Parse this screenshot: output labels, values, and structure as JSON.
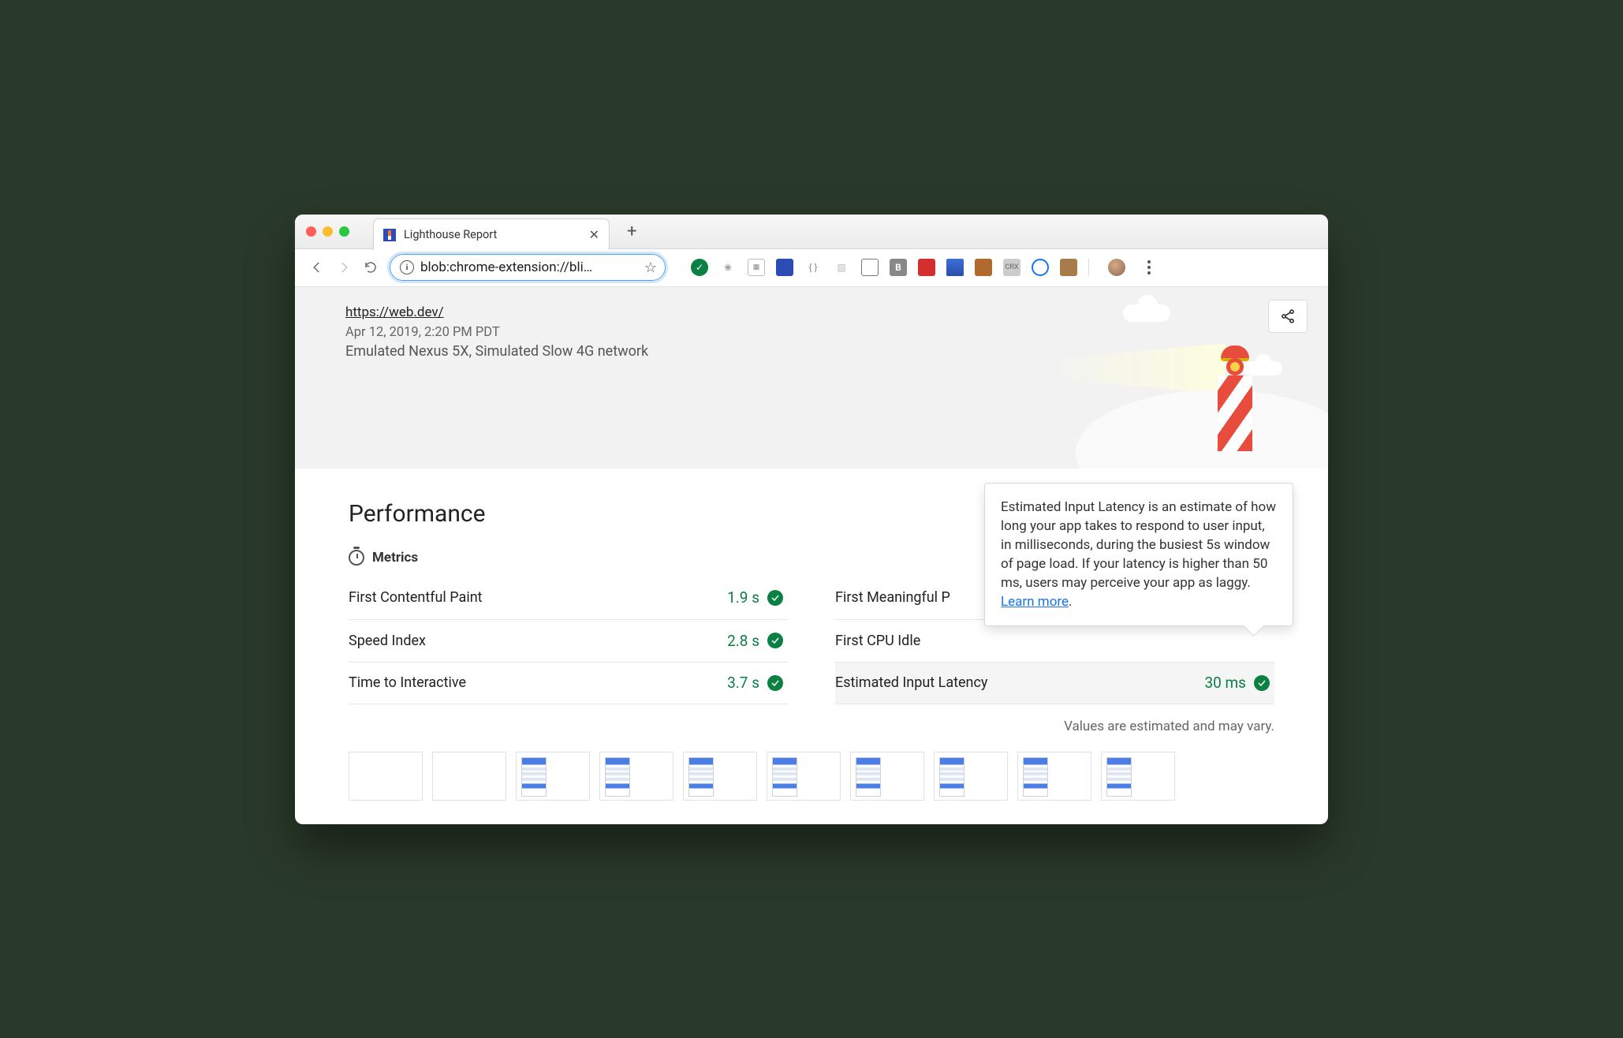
{
  "browser": {
    "tab_title": "Lighthouse Report",
    "url_display": "blob:chrome-extension://bli…"
  },
  "header": {
    "report_url": "https://web.dev/",
    "timestamp": "Apr 12, 2019, 2:20 PM PDT",
    "environment": "Emulated Nexus 5X, Simulated Slow 4G network"
  },
  "section_title": "Performance",
  "metrics_label": "Metrics",
  "metrics": {
    "left": [
      {
        "name": "First Contentful Paint",
        "value": "1.9 s"
      },
      {
        "name": "Speed Index",
        "value": "2.8 s"
      },
      {
        "name": "Time to Interactive",
        "value": "3.7 s"
      }
    ],
    "right": [
      {
        "name": "First Meaningful P",
        "value": ""
      },
      {
        "name": "First CPU Idle",
        "value": ""
      },
      {
        "name": "Estimated Input Latency",
        "value": "30 ms"
      }
    ]
  },
  "footnote": "Values are estimated and may vary.",
  "tooltip": {
    "text": "Estimated Input Latency is an estimate of how long your app takes to respond to user input, in milliseconds, during the busiest 5s window of page load. If your latency is higher than 50 ms, users may perceive your app as laggy. ",
    "link": "Learn more"
  }
}
